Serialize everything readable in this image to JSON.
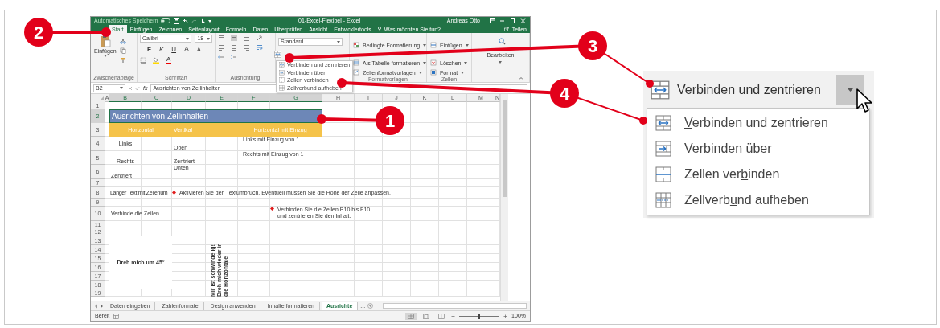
{
  "callouts": [
    {
      "number": "2"
    },
    {
      "number": "3"
    },
    {
      "number": "4"
    },
    {
      "number": "1"
    }
  ],
  "excel": {
    "title_bar": {
      "autosave_label": "Automatisches Speichern",
      "autosave_on": false,
      "title": "01-Excel-Flexibel - Excel",
      "user": "Andreas Otto"
    },
    "ribbon_tabs": [
      {
        "label": "Start",
        "selected": true
      },
      {
        "label": "Einfügen",
        "selected": false
      },
      {
        "label": "Zeichnen",
        "selected": false
      },
      {
        "label": "Seitenlayout",
        "selected": false
      },
      {
        "label": "Formeln",
        "selected": false
      },
      {
        "label": "Daten",
        "selected": false
      },
      {
        "label": "Überprüfen",
        "selected": false
      },
      {
        "label": "Ansicht",
        "selected": false
      },
      {
        "label": "Entwicklertools",
        "selected": false
      }
    ],
    "tell_me": "Was möchten Sie tun?",
    "share": "Teilen",
    "ribbon": {
      "clipboard": {
        "paste": "Einfügen",
        "group": "Zwischenablage"
      },
      "font": {
        "name": "Calibri",
        "size": "18",
        "style_buttons": [
          {
            "kind": "bold",
            "label": "F"
          },
          {
            "kind": "italic",
            "label": "K"
          },
          {
            "kind": "underline",
            "label": "U"
          }
        ],
        "size_buttons": [
          {
            "kind": "grow",
            "label": "A"
          },
          {
            "kind": "shrink",
            "label": "A"
          }
        ],
        "color_button": "A",
        "group": "Schriftart"
      },
      "alignment": {
        "group": "Ausrichtung"
      },
      "number": {
        "format": "Standard"
      },
      "styles": {
        "items": [
          "Bedingte Formatierung",
          "Als Tabelle formatieren",
          "Zellenformatvorlagen"
        ],
        "group": "Formatvorlagen"
      },
      "cells": {
        "items": [
          "Einfügen",
          "Löschen",
          "Format"
        ],
        "group": "Zellen"
      },
      "editing": {
        "label": "Bearbeiten"
      }
    },
    "merge_menu": [
      {
        "kind": "merge-center",
        "label": "Verbinden und zentrieren"
      },
      {
        "kind": "merge-across",
        "label": "Verbinden über"
      },
      {
        "kind": "merge-cells",
        "label": "Zellen verbinden"
      },
      {
        "kind": "unmerge",
        "label": "Zellverbund aufheben"
      }
    ],
    "formula_bar": {
      "name_box": "B2",
      "fx": "fx",
      "value": "Ausrichten von Zellinhalten"
    },
    "columns": [
      {
        "label": "A",
        "selected": false
      },
      {
        "label": "B",
        "selected": true
      },
      {
        "label": "C",
        "selected": true
      },
      {
        "label": "D",
        "selected": true
      },
      {
        "label": "E",
        "selected": true
      },
      {
        "label": "F",
        "selected": true
      },
      {
        "label": "G",
        "selected": true
      },
      {
        "label": "H",
        "selected": false
      },
      {
        "label": "I",
        "selected": false
      },
      {
        "label": "J",
        "selected": false
      },
      {
        "label": "K",
        "selected": false
      },
      {
        "label": "L",
        "selected": false
      },
      {
        "label": "M",
        "selected": false
      },
      {
        "label": "N",
        "selected": false
      }
    ],
    "rows": [
      {
        "label": "1",
        "selected": false
      },
      {
        "label": "2",
        "selected": true
      },
      {
        "label": "3",
        "selected": false
      },
      {
        "label": "4",
        "selected": false
      },
      {
        "label": "5",
        "selected": false
      },
      {
        "label": "6",
        "selected": false
      },
      {
        "label": "7",
        "selected": false
      },
      {
        "label": "8",
        "selected": false
      },
      {
        "label": "9",
        "selected": false
      },
      {
        "label": "10",
        "selected": false
      },
      {
        "label": "11",
        "selected": false
      },
      {
        "label": "12",
        "selected": false
      },
      {
        "label": "13",
        "selected": false
      },
      {
        "label": "14",
        "selected": false
      },
      {
        "label": "15",
        "selected": false
      },
      {
        "label": "16",
        "selected": false
      },
      {
        "label": "17",
        "selected": false
      },
      {
        "label": "18",
        "selected": false
      },
      {
        "label": "19",
        "selected": false
      }
    ],
    "cells": [
      {
        "kind": "title",
        "text": "Ausrichten von Zellinhalten"
      },
      {
        "kind": "header",
        "text": "Horizontal"
      },
      {
        "kind": "header",
        "text": "Vertikal"
      },
      {
        "kind": "header",
        "text": "Horizontal mit Einzug"
      },
      {
        "kind": "plain",
        "text": "Links"
      },
      {
        "kind": "plain",
        "text": "Oben"
      },
      {
        "kind": "plain",
        "text": "Links mit Einzug von 1"
      },
      {
        "kind": "plain",
        "text": "Rechts"
      },
      {
        "kind": "plain",
        "text": "Zentriert"
      },
      {
        "kind": "plain",
        "text": "Rechts mit Einzug von 1"
      },
      {
        "kind": "plain",
        "text": "Zentriert"
      },
      {
        "kind": "plain",
        "text": "Unten"
      },
      {
        "kind": "plain",
        "text": "Langer Text mit Zeilenum"
      },
      {
        "kind": "note",
        "text": "Aktivieren Sie den Textumbruch. Eventuell müssen Sie die Höhe der Zeile anpassen."
      },
      {
        "kind": "plain",
        "text": "Verbinde die Zeilen"
      },
      {
        "kind": "note",
        "text": "Verbinden Sie die Zellen B10 bis F10 und zentrieren Sie den Inhalt."
      },
      {
        "kind": "bold",
        "text": "Dreh mich um 45°"
      },
      {
        "kind": "rotated",
        "text": "Mir ist schwindelig! Dreh mich wieder in die Horizontale"
      }
    ],
    "sheet_tabs": [
      {
        "label": "Daten eingeben",
        "selected": false
      },
      {
        "label": "Zahlenformate",
        "selected": false
      },
      {
        "label": "Design anwenden",
        "selected": false
      },
      {
        "label": "Inhalte formatieren",
        "selected": false
      },
      {
        "label": "Ausrichte",
        "selected": true
      }
    ],
    "overflow_marker": "...",
    "status": "Bereit",
    "views": [
      {
        "kind": "normal",
        "selected": true
      },
      {
        "kind": "layout",
        "selected": false
      },
      {
        "kind": "pagebreak",
        "selected": false
      }
    ],
    "zoom": {
      "level": 0.5,
      "reading": "100%"
    }
  },
  "zoom_panel": {
    "button": "Verbinden und zentrieren",
    "menu": [
      {
        "kind": "merge-center",
        "key": "V",
        "after": "erbinden und zentrieren"
      },
      {
        "kind": "merge-across",
        "before": "Verbin",
        "key": "d",
        "after": "en über"
      },
      {
        "kind": "merge-cells",
        "before": "Zellen ver",
        "key": "b",
        "after": "inden"
      },
      {
        "kind": "unmerge",
        "before": "Zellverb",
        "key": "u",
        "after": "nd aufheben"
      }
    ]
  }
}
